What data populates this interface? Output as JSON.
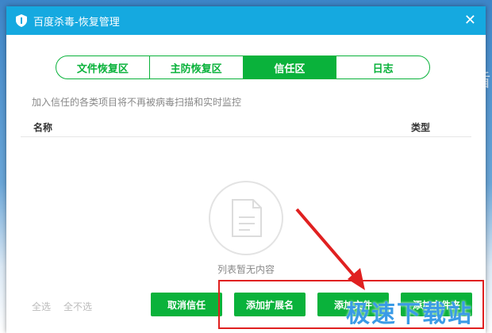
{
  "window": {
    "title": "百度杀毒-恢复管理"
  },
  "tabs": [
    "文件恢复区",
    "主防恢复区",
    "信任区",
    "日志"
  ],
  "active_tab": "信任区",
  "hint": "加入信任的各类项目将不再被病毒扫描和实时监控",
  "table": {
    "columns": [
      "名称",
      "类型"
    ],
    "empty_text": "列表暂无内容"
  },
  "footer": {
    "select_all": "全选",
    "deselect_all": "全不选",
    "buttons": [
      "取消信任",
      "添加扩展名",
      "添加文件",
      "添加文件夹"
    ]
  },
  "watermark": "极速下载站",
  "background": {
    "partial_text": "盾"
  },
  "colors": {
    "title_bar": "#15a9e0",
    "accent_green": "#0ab23b",
    "highlight_red": "#e02020"
  }
}
